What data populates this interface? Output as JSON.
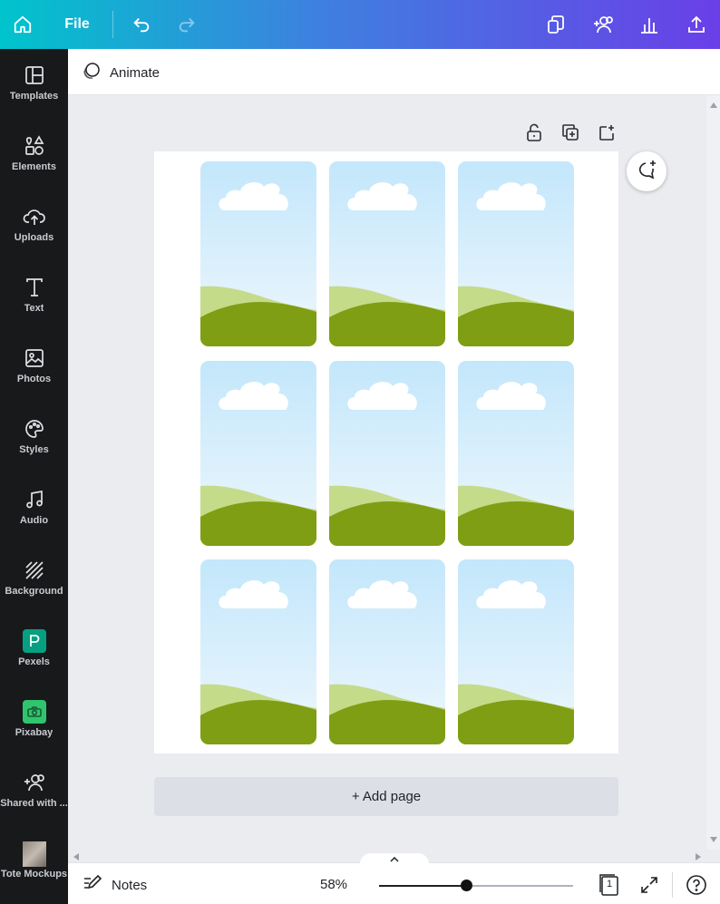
{
  "topbar": {
    "file_label": "File",
    "icons": [
      "home-icon",
      "undo-icon",
      "redo-icon",
      "resize-icon",
      "share-people-icon",
      "insights-icon",
      "upload-icon"
    ]
  },
  "sidebar": {
    "items": [
      {
        "label": "Templates",
        "icon": "templates-icon"
      },
      {
        "label": "Elements",
        "icon": "elements-icon"
      },
      {
        "label": "Uploads",
        "icon": "uploads-icon"
      },
      {
        "label": "Text",
        "icon": "text-icon"
      },
      {
        "label": "Photos",
        "icon": "photos-icon"
      },
      {
        "label": "Styles",
        "icon": "styles-icon"
      },
      {
        "label": "Audio",
        "icon": "audio-icon"
      },
      {
        "label": "Background",
        "icon": "background-icon"
      },
      {
        "label": "Pexels",
        "icon": "pexels-icon"
      },
      {
        "label": "Pixabay",
        "icon": "pixabay-icon"
      },
      {
        "label": "Shared with ...",
        "icon": "shared-icon"
      },
      {
        "label": "Tote Mockups",
        "icon": "tote-mockups-thumbnail"
      }
    ]
  },
  "toolbar": {
    "animate_label": "Animate"
  },
  "canvas": {
    "add_page_label": "+ Add page",
    "card_count": 9,
    "colors": {
      "sky_top": "#c3e7fb",
      "sky_bottom": "#eef7fd",
      "hill_light": "#c4db8a",
      "hill_dark": "#7f9e13",
      "cloud": "#ffffff"
    }
  },
  "bottombar": {
    "notes_label": "Notes",
    "zoom_label": "58%",
    "zoom_fraction": 0.45,
    "page_count": "1"
  }
}
